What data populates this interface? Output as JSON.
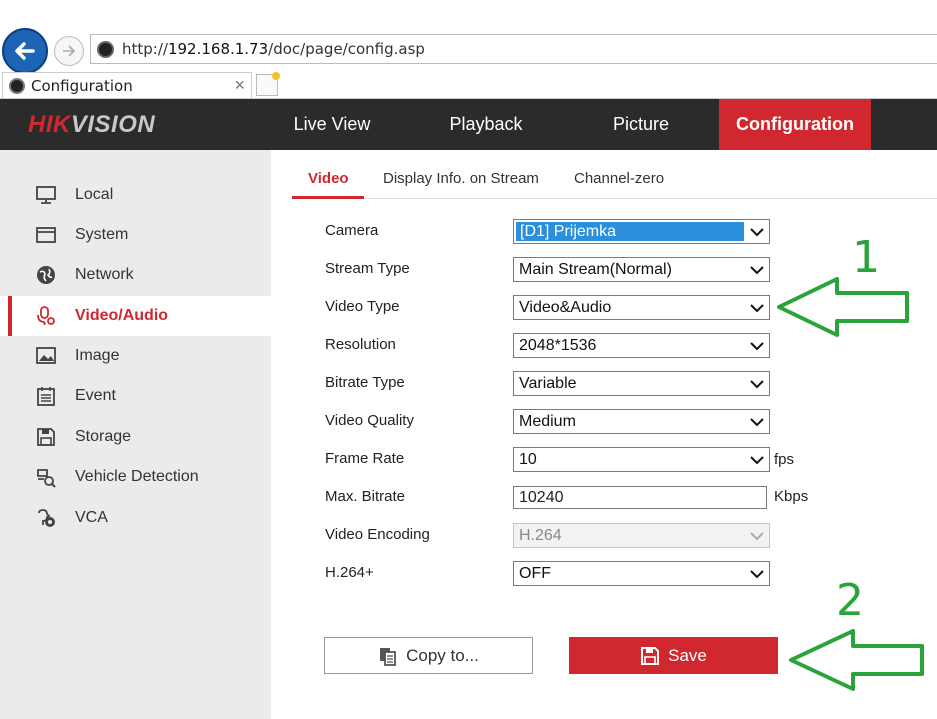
{
  "browser": {
    "url_prefix": "http://",
    "url_host": "192.168.1.73",
    "url_path": "/doc/page/config.asp",
    "tab_title": "Configuration",
    "tab_close": "×"
  },
  "header": {
    "logo_hik": "HIK",
    "logo_vision": "VISION",
    "nav": [
      "Live View",
      "Playback",
      "Picture",
      "Configuration"
    ],
    "active_nav": "Configuration"
  },
  "sidebar": {
    "items": [
      {
        "label": "Local",
        "icon": "monitor-icon"
      },
      {
        "label": "System",
        "icon": "window-icon"
      },
      {
        "label": "Network",
        "icon": "globe-icon"
      },
      {
        "label": "Video/Audio",
        "icon": "microphone-icon"
      },
      {
        "label": "Image",
        "icon": "image-icon"
      },
      {
        "label": "Event",
        "icon": "calendar-icon"
      },
      {
        "label": "Storage",
        "icon": "floppy-icon"
      },
      {
        "label": "Vehicle Detection",
        "icon": "vehicle-search-icon"
      },
      {
        "label": "VCA",
        "icon": "vca-icon"
      }
    ],
    "active": "Video/Audio"
  },
  "subtabs": [
    "Video",
    "Display Info. on Stream",
    "Channel-zero"
  ],
  "form": {
    "camera_label": "Camera",
    "camera_value": "[D1] Prijemka",
    "stream_type_label": "Stream Type",
    "stream_type_value": "Main Stream(Normal)",
    "video_type_label": "Video Type",
    "video_type_value": "Video&Audio",
    "resolution_label": "Resolution",
    "resolution_value": "2048*1536",
    "bitrate_type_label": "Bitrate Type",
    "bitrate_type_value": "Variable",
    "video_quality_label": "Video Quality",
    "video_quality_value": "Medium",
    "frame_rate_label": "Frame Rate",
    "frame_rate_value": "10",
    "frame_rate_unit": "fps",
    "max_bitrate_label": "Max. Bitrate",
    "max_bitrate_value": "10240",
    "max_bitrate_unit": "Kbps",
    "video_encoding_label": "Video Encoding",
    "video_encoding_value": "H.264",
    "h264plus_label": "H.264+",
    "h264plus_value": "OFF"
  },
  "buttons": {
    "copy_label": "Copy to...",
    "save_label": "Save"
  },
  "annotations": {
    "arrow1_number": "1",
    "arrow2_number": "2",
    "color": "#2aa43a"
  },
  "colors": {
    "accent": "#d0282e",
    "header_bg": "#2b2b2b",
    "sidebar_bg": "#ebebeb",
    "selection": "#2a8fdd"
  }
}
